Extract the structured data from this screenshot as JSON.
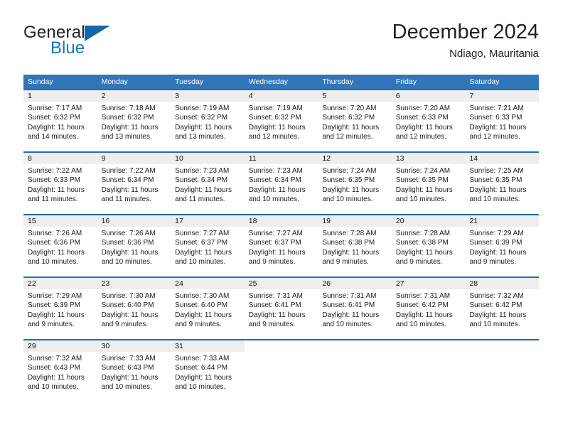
{
  "brand": {
    "name_part1": "General",
    "name_part2": "Blue",
    "logo_icon": "blue-triangle-logo"
  },
  "header": {
    "month_title": "December 2024",
    "location": "Ndiago, Mauritania"
  },
  "colors": {
    "header_blue": "#3076b8",
    "row_divider_blue": "#1f6eb4",
    "daynum_band_gray": "#eeeeee",
    "brand_blue": "#1277bc",
    "text_dark": "#1a1a1a"
  },
  "calendar": {
    "weekdays": [
      "Sunday",
      "Monday",
      "Tuesday",
      "Wednesday",
      "Thursday",
      "Friday",
      "Saturday"
    ],
    "weeks": [
      [
        {
          "day": "1",
          "sunrise": "Sunrise: 7:17 AM",
          "sunset": "Sunset: 6:32 PM",
          "daylight_line1": "Daylight: 11 hours",
          "daylight_line2": "and 14 minutes."
        },
        {
          "day": "2",
          "sunrise": "Sunrise: 7:18 AM",
          "sunset": "Sunset: 6:32 PM",
          "daylight_line1": "Daylight: 11 hours",
          "daylight_line2": "and 13 minutes."
        },
        {
          "day": "3",
          "sunrise": "Sunrise: 7:19 AM",
          "sunset": "Sunset: 6:32 PM",
          "daylight_line1": "Daylight: 11 hours",
          "daylight_line2": "and 13 minutes."
        },
        {
          "day": "4",
          "sunrise": "Sunrise: 7:19 AM",
          "sunset": "Sunset: 6:32 PM",
          "daylight_line1": "Daylight: 11 hours",
          "daylight_line2": "and 12 minutes."
        },
        {
          "day": "5",
          "sunrise": "Sunrise: 7:20 AM",
          "sunset": "Sunset: 6:32 PM",
          "daylight_line1": "Daylight: 11 hours",
          "daylight_line2": "and 12 minutes."
        },
        {
          "day": "6",
          "sunrise": "Sunrise: 7:20 AM",
          "sunset": "Sunset: 6:33 PM",
          "daylight_line1": "Daylight: 11 hours",
          "daylight_line2": "and 12 minutes."
        },
        {
          "day": "7",
          "sunrise": "Sunrise: 7:21 AM",
          "sunset": "Sunset: 6:33 PM",
          "daylight_line1": "Daylight: 11 hours",
          "daylight_line2": "and 12 minutes."
        }
      ],
      [
        {
          "day": "8",
          "sunrise": "Sunrise: 7:22 AM",
          "sunset": "Sunset: 6:33 PM",
          "daylight_line1": "Daylight: 11 hours",
          "daylight_line2": "and 11 minutes."
        },
        {
          "day": "9",
          "sunrise": "Sunrise: 7:22 AM",
          "sunset": "Sunset: 6:34 PM",
          "daylight_line1": "Daylight: 11 hours",
          "daylight_line2": "and 11 minutes."
        },
        {
          "day": "10",
          "sunrise": "Sunrise: 7:23 AM",
          "sunset": "Sunset: 6:34 PM",
          "daylight_line1": "Daylight: 11 hours",
          "daylight_line2": "and 11 minutes."
        },
        {
          "day": "11",
          "sunrise": "Sunrise: 7:23 AM",
          "sunset": "Sunset: 6:34 PM",
          "daylight_line1": "Daylight: 11 hours",
          "daylight_line2": "and 10 minutes."
        },
        {
          "day": "12",
          "sunrise": "Sunrise: 7:24 AM",
          "sunset": "Sunset: 6:35 PM",
          "daylight_line1": "Daylight: 11 hours",
          "daylight_line2": "and 10 minutes."
        },
        {
          "day": "13",
          "sunrise": "Sunrise: 7:24 AM",
          "sunset": "Sunset: 6:35 PM",
          "daylight_line1": "Daylight: 11 hours",
          "daylight_line2": "and 10 minutes."
        },
        {
          "day": "14",
          "sunrise": "Sunrise: 7:25 AM",
          "sunset": "Sunset: 6:35 PM",
          "daylight_line1": "Daylight: 11 hours",
          "daylight_line2": "and 10 minutes."
        }
      ],
      [
        {
          "day": "15",
          "sunrise": "Sunrise: 7:26 AM",
          "sunset": "Sunset: 6:36 PM",
          "daylight_line1": "Daylight: 11 hours",
          "daylight_line2": "and 10 minutes."
        },
        {
          "day": "16",
          "sunrise": "Sunrise: 7:26 AM",
          "sunset": "Sunset: 6:36 PM",
          "daylight_line1": "Daylight: 11 hours",
          "daylight_line2": "and 10 minutes."
        },
        {
          "day": "17",
          "sunrise": "Sunrise: 7:27 AM",
          "sunset": "Sunset: 6:37 PM",
          "daylight_line1": "Daylight: 11 hours",
          "daylight_line2": "and 10 minutes."
        },
        {
          "day": "18",
          "sunrise": "Sunrise: 7:27 AM",
          "sunset": "Sunset: 6:37 PM",
          "daylight_line1": "Daylight: 11 hours",
          "daylight_line2": "and 9 minutes."
        },
        {
          "day": "19",
          "sunrise": "Sunrise: 7:28 AM",
          "sunset": "Sunset: 6:38 PM",
          "daylight_line1": "Daylight: 11 hours",
          "daylight_line2": "and 9 minutes."
        },
        {
          "day": "20",
          "sunrise": "Sunrise: 7:28 AM",
          "sunset": "Sunset: 6:38 PM",
          "daylight_line1": "Daylight: 11 hours",
          "daylight_line2": "and 9 minutes."
        },
        {
          "day": "21",
          "sunrise": "Sunrise: 7:29 AM",
          "sunset": "Sunset: 6:39 PM",
          "daylight_line1": "Daylight: 11 hours",
          "daylight_line2": "and 9 minutes."
        }
      ],
      [
        {
          "day": "22",
          "sunrise": "Sunrise: 7:29 AM",
          "sunset": "Sunset: 6:39 PM",
          "daylight_line1": "Daylight: 11 hours",
          "daylight_line2": "and 9 minutes."
        },
        {
          "day": "23",
          "sunrise": "Sunrise: 7:30 AM",
          "sunset": "Sunset: 6:40 PM",
          "daylight_line1": "Daylight: 11 hours",
          "daylight_line2": "and 9 minutes."
        },
        {
          "day": "24",
          "sunrise": "Sunrise: 7:30 AM",
          "sunset": "Sunset: 6:40 PM",
          "daylight_line1": "Daylight: 11 hours",
          "daylight_line2": "and 9 minutes."
        },
        {
          "day": "25",
          "sunrise": "Sunrise: 7:31 AM",
          "sunset": "Sunset: 6:41 PM",
          "daylight_line1": "Daylight: 11 hours",
          "daylight_line2": "and 9 minutes."
        },
        {
          "day": "26",
          "sunrise": "Sunrise: 7:31 AM",
          "sunset": "Sunset: 6:41 PM",
          "daylight_line1": "Daylight: 11 hours",
          "daylight_line2": "and 10 minutes."
        },
        {
          "day": "27",
          "sunrise": "Sunrise: 7:31 AM",
          "sunset": "Sunset: 6:42 PM",
          "daylight_line1": "Daylight: 11 hours",
          "daylight_line2": "and 10 minutes."
        },
        {
          "day": "28",
          "sunrise": "Sunrise: 7:32 AM",
          "sunset": "Sunset: 6:42 PM",
          "daylight_line1": "Daylight: 11 hours",
          "daylight_line2": "and 10 minutes."
        }
      ],
      [
        {
          "day": "29",
          "sunrise": "Sunrise: 7:32 AM",
          "sunset": "Sunset: 6:43 PM",
          "daylight_line1": "Daylight: 11 hours",
          "daylight_line2": "and 10 minutes."
        },
        {
          "day": "30",
          "sunrise": "Sunrise: 7:33 AM",
          "sunset": "Sunset: 6:43 PM",
          "daylight_line1": "Daylight: 11 hours",
          "daylight_line2": "and 10 minutes."
        },
        {
          "day": "31",
          "sunrise": "Sunrise: 7:33 AM",
          "sunset": "Sunset: 6:44 PM",
          "daylight_line1": "Daylight: 11 hours",
          "daylight_line2": "and 10 minutes."
        },
        {
          "day": "",
          "sunrise": "",
          "sunset": "",
          "daylight_line1": "",
          "daylight_line2": ""
        },
        {
          "day": "",
          "sunrise": "",
          "sunset": "",
          "daylight_line1": "",
          "daylight_line2": ""
        },
        {
          "day": "",
          "sunrise": "",
          "sunset": "",
          "daylight_line1": "",
          "daylight_line2": ""
        },
        {
          "day": "",
          "sunrise": "",
          "sunset": "",
          "daylight_line1": "",
          "daylight_line2": ""
        }
      ]
    ]
  }
}
